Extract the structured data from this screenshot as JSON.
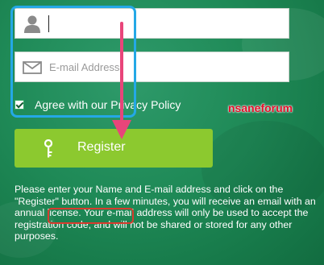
{
  "form": {
    "name_value": "",
    "email_placeholder": "E-mail Address",
    "agree_text": "Agree with our",
    "privacy_link": "Privacy Policy",
    "agree_checked": true,
    "register_label": "Register"
  },
  "info_text": "Please enter your Name and E-mail address and click on the \"Register\" button. In a few minutes, you will receive an email with an annual license. Your e-mail address will only be used to accept the registration code, and will not be shared or stored for any other purposes.",
  "watermark": "nsaneforum",
  "icons": {
    "name": "user-icon",
    "email": "envelope-icon",
    "register": "key-icon"
  },
  "colors": {
    "background": "#1f8a57",
    "button": "#8cc92f",
    "highlight_blue": "#24a8e6",
    "highlight_red": "#d83b2e",
    "arrow": "#e8457a",
    "watermark": "#e4102a"
  }
}
